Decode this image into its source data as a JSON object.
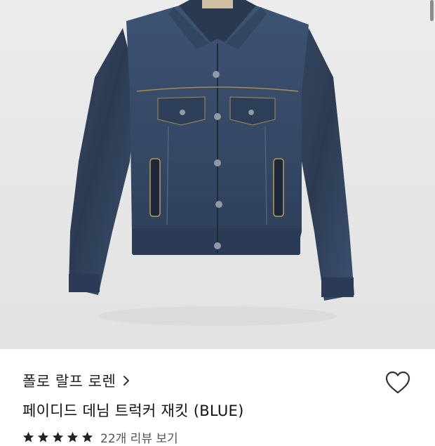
{
  "product": {
    "brand": "폴로 랄프 로렌",
    "name": "페이디드 데님 트럭커 재킷 (BLUE)",
    "rating_stars": 5,
    "reviews_text": "22개 리뷰 보기"
  },
  "colors": {
    "denim_dark": "#2b3a52",
    "denim_mid": "#3a4e6c",
    "background": "#e8e8e8",
    "star": "#222222"
  },
  "icons": {
    "brand_chevron": "chevron-right-icon",
    "wishlist": "heart-outline-icon",
    "rating": "star-icon"
  }
}
